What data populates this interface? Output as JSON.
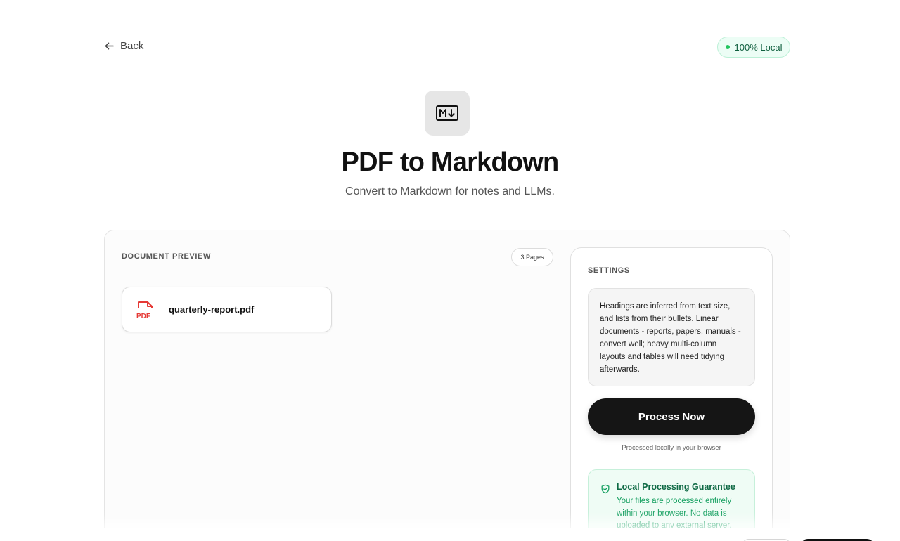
{
  "header": {
    "back_label": "Back",
    "badge_label": "100% Local"
  },
  "hero": {
    "icon": "markdown-icon",
    "title": "PDF to Markdown",
    "subtitle": "Convert to Markdown for notes and LLMs."
  },
  "preview": {
    "label": "DOCUMENT PREVIEW",
    "pages_badge": "3 Pages",
    "file": {
      "icon": "pdf-file-icon",
      "name": "quarterly-report.pdf"
    }
  },
  "settings": {
    "label": "SETTINGS",
    "info_text": "Headings are inferred from text size, and lists from their bullets. Linear documents - reports, papers, manuals - convert well; heavy multi-column layouts and tables will need tidying afterwards.",
    "process_button": "Process Now",
    "local_note": "Processed locally in your browser",
    "guarantee": {
      "icon": "shield-check-icon",
      "title": "Local Processing Guarantee",
      "text": "Your files are processed entirely within your browser. No data is uploaded to any external server."
    }
  },
  "colors": {
    "accent_green": "#16a061",
    "badge_dot": "#22c55e",
    "primary_button": "#151515",
    "pdf_red": "#e53935"
  }
}
